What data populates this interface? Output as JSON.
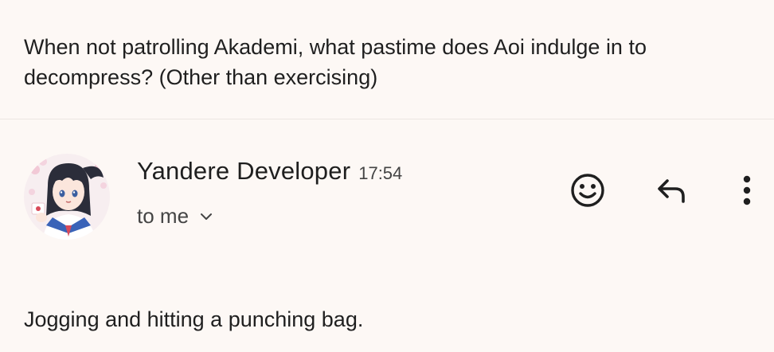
{
  "quoted_message": {
    "text": "When not patrolling Akademi, what pastime does Aoi indulge in to decompress? (Other than exercising)"
  },
  "sender": {
    "name": "Yandere Developer",
    "time": "17:54",
    "avatar_icon": "anime-girl-avatar"
  },
  "recipient": {
    "label": "to me",
    "expand_icon": "chevron-down-icon"
  },
  "actions": {
    "react_icon": "emoji-smile-icon",
    "reply_icon": "reply-icon",
    "more_icon": "more-vertical-icon"
  },
  "message": {
    "body": "Jogging and hitting a punching bag."
  },
  "colors": {
    "background": "#fdf8f5",
    "text": "#1f1f1f",
    "secondary_text": "#444444",
    "divider": "#ece6e2"
  }
}
